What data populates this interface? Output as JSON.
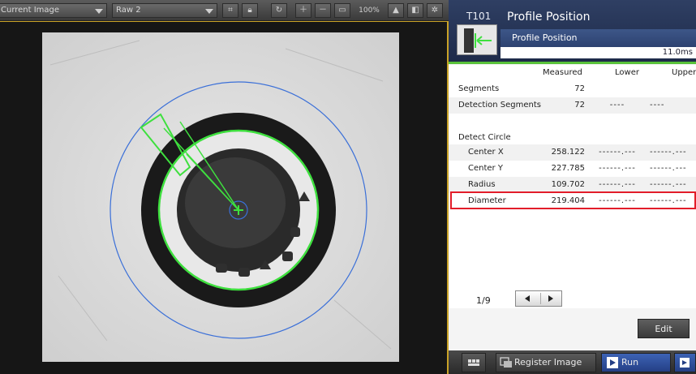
{
  "toolbar": {
    "image_select": "Current Image",
    "camera_select": "Raw 2",
    "zoom": "100%"
  },
  "tool": {
    "id": "T101",
    "title": "Profile Position",
    "subtitle": "Profile Position",
    "time": "11.0ms"
  },
  "results": {
    "columns": {
      "measured": "Measured",
      "lower": "Lower",
      "upper": "Upper"
    },
    "segments": {
      "label": "Segments",
      "value": "72"
    },
    "detection_segments": {
      "label": "Detection Segments",
      "value": "72",
      "lower": "----",
      "upper": "----"
    },
    "section_label": "Detect Circle",
    "center_x": {
      "label": "Center X",
      "value": "258.122",
      "lower": "------.---",
      "upper": "------.---"
    },
    "center_y": {
      "label": "Center Y",
      "value": "227.785",
      "lower": "------.---",
      "upper": "------.---"
    },
    "radius": {
      "label": "Radius",
      "value": "109.702",
      "lower": "------.---",
      "upper": "------.---"
    },
    "diameter": {
      "label": "Diameter",
      "value": "219.404",
      "lower": "------.---",
      "upper": "------.---"
    }
  },
  "pager": {
    "text": "1/9"
  },
  "buttons": {
    "edit": "Edit",
    "register_image": "Register Image",
    "run": "Run"
  },
  "colors": {
    "accent_border": "#c9a227",
    "header_bg": "#1d2a49",
    "status_green": "#59c23a",
    "highlight_red": "#e21d2a",
    "run_blue": "#243f85"
  }
}
